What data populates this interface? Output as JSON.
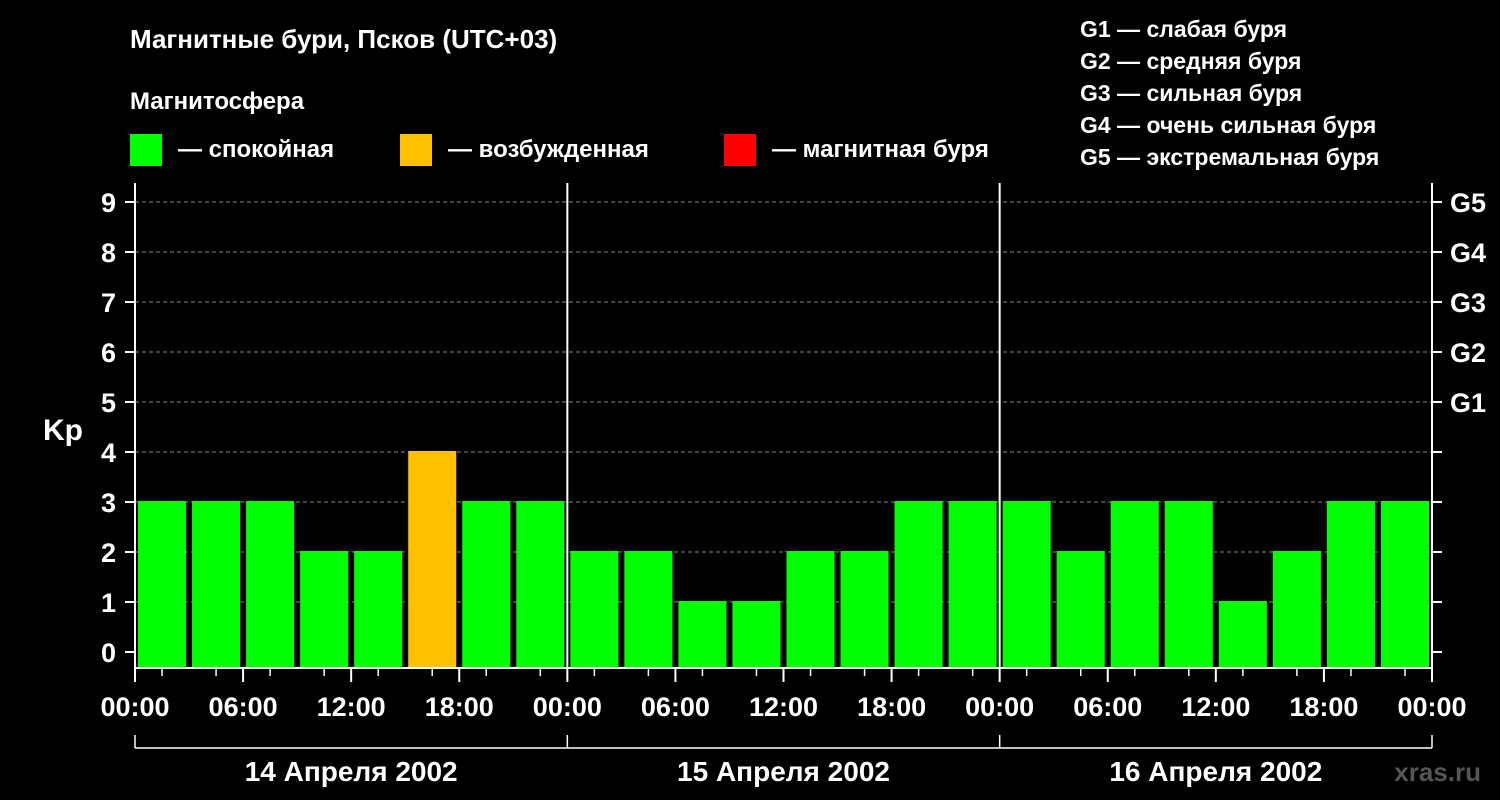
{
  "colors": {
    "background": "#000000",
    "quiet": "#00ff00",
    "excited": "#ffc000",
    "storm": "#ff0000",
    "text": "#ffffff",
    "grid": "#888888"
  },
  "header": {
    "title": "Магнитные бури, Псков (UTC+03)",
    "legend_title": "Магнитосфера",
    "legend": [
      {
        "key": "quiet",
        "label": "— спокойная"
      },
      {
        "key": "excited",
        "label": "— возбужденная"
      },
      {
        "key": "storm",
        "label": "— магнитная буря"
      }
    ],
    "storm_scale": [
      "G1 — слабая буря",
      "G2 — средняя буря",
      "G3 — сильная буря",
      "G4 — очень сильная буря",
      "G5 — экстремальная буря"
    ]
  },
  "watermark": "xras.ru",
  "chart_data": {
    "type": "bar",
    "ylabel": "Kp",
    "ylim": [
      0,
      9
    ],
    "yticks": [
      "0",
      "1",
      "2",
      "3",
      "4",
      "5",
      "6",
      "7",
      "8",
      "9"
    ],
    "right_ticks": [
      {
        "y": 5,
        "label": "G1"
      },
      {
        "y": 6,
        "label": "G2"
      },
      {
        "y": 7,
        "label": "G3"
      },
      {
        "y": 8,
        "label": "G4"
      },
      {
        "y": 9,
        "label": "G5"
      }
    ],
    "xticks": [
      "00:00",
      "06:00",
      "12:00",
      "18:00",
      "00:00",
      "06:00",
      "12:00",
      "18:00",
      "00:00",
      "06:00",
      "12:00",
      "18:00",
      "00:00"
    ],
    "days": [
      "14 Апреля 2002",
      "15 Апреля 2002",
      "16 Апреля 2002"
    ],
    "values": [
      3,
      3,
      3,
      2,
      2,
      4,
      3,
      3,
      2,
      2,
      1,
      1,
      2,
      2,
      3,
      3,
      3,
      2,
      3,
      3,
      1,
      2,
      3,
      3
    ],
    "levels": [
      "quiet",
      "quiet",
      "quiet",
      "quiet",
      "quiet",
      "excited",
      "quiet",
      "quiet",
      "quiet",
      "quiet",
      "quiet",
      "quiet",
      "quiet",
      "quiet",
      "quiet",
      "quiet",
      "quiet",
      "quiet",
      "quiet",
      "quiet",
      "quiet",
      "quiet",
      "quiet",
      "quiet"
    ],
    "grid": true
  }
}
